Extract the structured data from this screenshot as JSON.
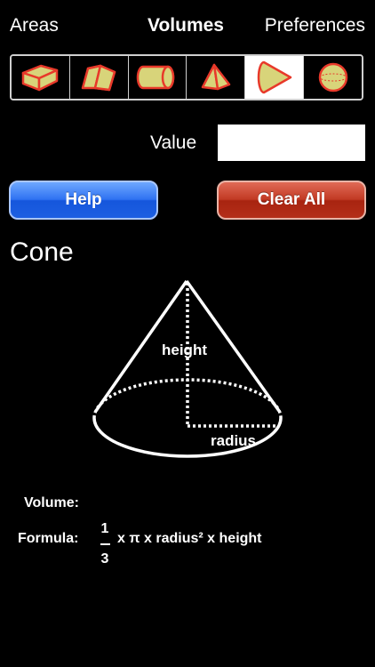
{
  "nav": {
    "areas": "Areas",
    "volumes": "Volumes",
    "preferences": "Preferences"
  },
  "shapes": {
    "items": [
      "cuboid-icon",
      "prism-icon",
      "cylinder-icon",
      "pyramid-icon",
      "cone-icon",
      "sphere-icon"
    ],
    "selected": "cone-icon",
    "fill_color": "#d8d47a",
    "stroke_color": "#e8392a"
  },
  "value": {
    "label": "Value",
    "current": ""
  },
  "buttons": {
    "help": "Help",
    "clear_all": "Clear All",
    "help_color": "#2f72f2",
    "clear_color": "#c23a24"
  },
  "shape_title": "Cone",
  "diagram": {
    "height_label": "height",
    "radius_label": "radius"
  },
  "info": {
    "volume_label": "Volume:",
    "volume_value": "",
    "formula_label": "Formula:",
    "fraction_numerator": "1",
    "fraction_denominator": "3",
    "formula_text": "x π x radius² x height"
  }
}
